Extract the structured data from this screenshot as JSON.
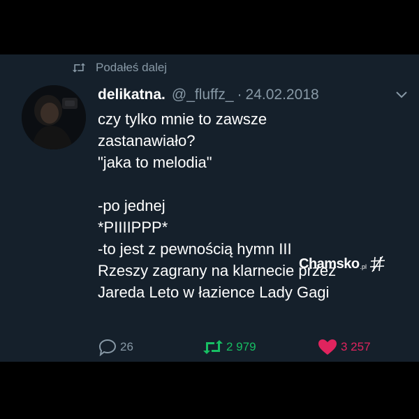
{
  "colors": {
    "card_background": "#15202b",
    "page_background": "#000000",
    "secondary_text": "#8899a6",
    "primary_text": "#ffffff",
    "retweet_green": "#17bf63",
    "like_red": "#e0245e"
  },
  "retweet_context": {
    "icon": "retweet-icon",
    "label": "Podałeś dalej"
  },
  "author": {
    "display_name": "delikatna.",
    "handle": "@_fluffz_",
    "separator": "·",
    "date": "24.02.2018",
    "menu_icon": "chevron-down-icon"
  },
  "tweet": {
    "lines": [
      "czy tylko mnie to zawsze",
      "zastanawiało?",
      "\"jaka to melodia\"",
      "",
      "-po jednej",
      "*PIIIIPPP*",
      "-to jest z pewnością hymn III",
      "Rzeszy zagrany na klarnecie przez",
      "Jareda Leto w łazience Lady Gagi"
    ]
  },
  "actions": {
    "reply": {
      "icon": "reply-icon",
      "count": "26"
    },
    "retweet": {
      "icon": "retweet-icon",
      "count": "2 979"
    },
    "like": {
      "icon": "heart-icon",
      "count": "3 257"
    }
  },
  "watermark": {
    "brand": "Chamsko",
    "tld": ".pl",
    "logo_icon": "hash-logo-icon"
  }
}
